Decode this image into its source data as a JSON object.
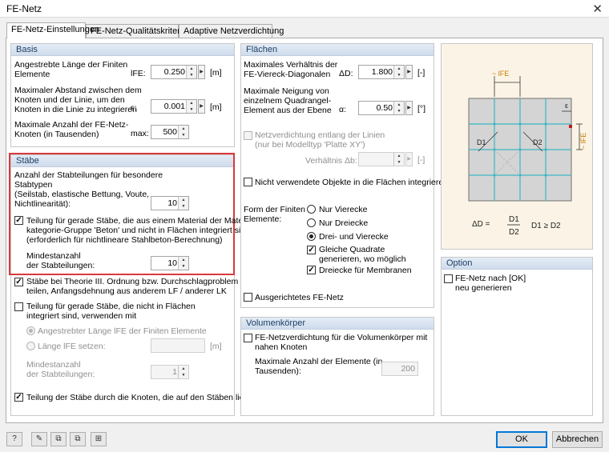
{
  "window": {
    "title": "FE-Netz"
  },
  "tabs": [
    "FE-Netz-Einstellungen",
    "FE-Netz-Qualitätskriterien",
    "Adaptive Netzverdichtung"
  ],
  "basis": {
    "title": "Basis",
    "row1_label": "Angestrebte Länge der Finiten\nElemente",
    "row1_symbol": "lFE:",
    "row1_value": "0.250",
    "row1_unit": "[m]",
    "row2_label": "Maximaler Abstand zwischen dem\nKnoten und der Linie, um den\nKnoten in die Linie zu integrieren",
    "row2_symbol": "ε:",
    "row2_value": "0.001",
    "row2_unit": "[m]",
    "row3_label": "Maximale Anzahl der FE-Netz-\nKnoten (in Tausenden)",
    "row3_symbol": "max:",
    "row3_value": "500"
  },
  "staebe": {
    "title": "Stäbe",
    "count_label": "Anzahl der Stabteilungen für besondere\nStabtypen\n(Seilstab, elastische Bettung, Voute,\nNichtlinearität):",
    "count_value": "10",
    "beton_label": "Teilung für gerade Stäbe, die aus einem Material der Material-\nkategorie-Gruppe 'Beton' und nicht in Flächen integriert sind.\n(erforderlich für nichtlineare Stahlbeton-Berechnung)",
    "min_label": "Mindestanzahl\nder Stabteilungen:",
    "min_value": "10",
    "theorie_label": "Stäbe bei Theorie III. Ordnung bzw. Durchschlagproblem\nteilen, Anfangsdehnung aus anderem LF / anderer LK",
    "gerade_label": "Teilung für gerade Stäbe, die nicht in Flächen\nintegriert sind, verwenden mit",
    "opt1_label": "Angestrebter Länge lFE der Finiten Elemente",
    "opt2_label": "Länge lFE setzen:",
    "opt2_unit": "[m]",
    "min2_label": "Mindestanzahl\nder Stabteilungen:",
    "min2_value": "1",
    "knoten_label": "Teilung der Stäbe durch die Knoten, die auf den Stäben liegen"
  },
  "flaechen": {
    "title": "Flächen",
    "diag_label": "Maximales Verhältnis der\nFE-Viereck-Diagonalen",
    "diag_symbol": "ΔD:",
    "diag_value": "1.800",
    "diag_unit": "[-]",
    "neig_label": "Maximale Neigung von\neinzelnem Quadrangel-\nElement aus der Ebene",
    "neig_symbol": "α:",
    "neig_value": "0.50",
    "neig_unit": "[°]",
    "verd_label": "Netzverdichtung entlang der Linien\n(nur bei Modelltyp 'Platte XY')",
    "verh_label": "Verhältnis Δb:",
    "verh_unit": "[-]",
    "unused_label": "Nicht verwendete Objekte in die Flächen integrieren",
    "form_label": "Form der Finiten\nElemente:",
    "form_opts": [
      "Nur Vierecke",
      "Nur Dreiecke",
      "Drei- und Vierecke"
    ],
    "gleich_label": "Gleiche Quadrate\ngenerieren, wo möglich",
    "dreieck_label": "Dreiecke für Membranen",
    "ausg_label": "Ausgerichtetes FE-Netz"
  },
  "volumen": {
    "title": "Volumenkörper",
    "verd_label": "FE-Netzverdichtung für die Volumenkörper mit\nnahen Knoten",
    "max_label": "Maximale Anzahl der Elemente (in\nTausenden):",
    "max_value": "200"
  },
  "illustration": {
    "top_label": "~ lFE",
    "side_label": "~ lFE",
    "eps": "ε",
    "d1": "D1",
    "d2": "D2",
    "formula": "ΔD =",
    "cond": "D1 ≥ D2"
  },
  "option": {
    "title": "Option",
    "regen_label": "FE-Netz nach [OK]\nneu generieren"
  },
  "footer": {
    "ok": "OK",
    "cancel": "Abbrechen"
  }
}
